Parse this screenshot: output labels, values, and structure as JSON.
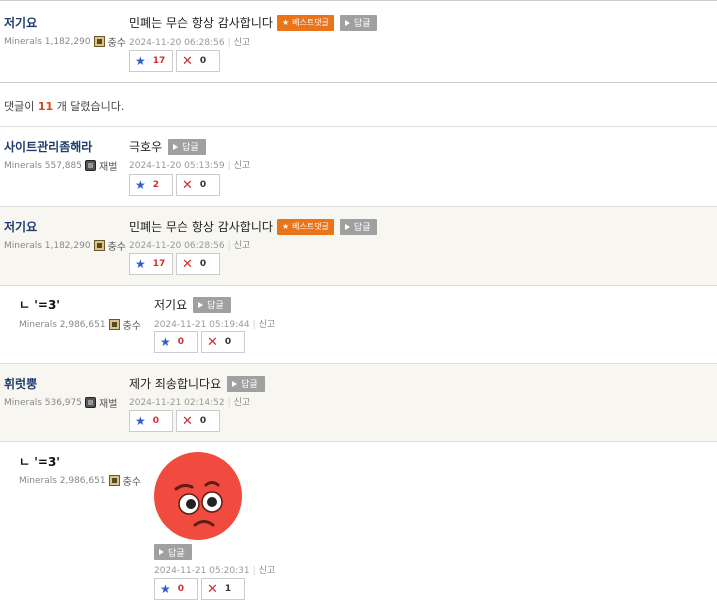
{
  "best_comment": {
    "nick": "저기요",
    "minerals": "Minerals 1,182,290",
    "rank": "충수",
    "text": "민폐는 무슨 항상 감사합니다",
    "best_label": "베스트댓글",
    "reply_label": "답글",
    "time": "2024-11-20 06:28:56",
    "report": "신고",
    "up": "17",
    "down": "0"
  },
  "count_line": {
    "prefix": "댓글이",
    "count": "11",
    "suffix": "개 달렸습니다."
  },
  "comments": [
    {
      "nick": "사이트관리좀해라",
      "minerals": "Minerals 557,885",
      "rank": "재벌",
      "text": "극호우",
      "reply_label": "답글",
      "time": "2024-11-20 05:13:59",
      "report": "신고",
      "up": "2",
      "down": "0"
    },
    {
      "nick": "저기요",
      "minerals": "Minerals 1,182,290",
      "rank": "충수",
      "text": "민폐는 무슨 항상 감사합니다",
      "best_label": "베스트댓글",
      "reply_label": "답글",
      "time": "2024-11-20 06:28:56",
      "report": "신고",
      "up": "17",
      "down": "0"
    },
    {
      "nick": "ㄴ '=3'",
      "minerals": "Minerals 2,986,651",
      "rank": "충수",
      "text": "저기요",
      "reply_label": "답글",
      "time": "2024-11-21 05:19:44",
      "report": "신고",
      "up": "0",
      "down": "0"
    },
    {
      "nick": "휘럿뿡",
      "minerals": "Minerals 536,975",
      "rank": "재벌",
      "text": "제가 죄송합니다요",
      "reply_label": "답글",
      "time": "2024-11-21 02:14:52",
      "report": "신고",
      "up": "0",
      "down": "0"
    },
    {
      "nick": "ㄴ '=3'",
      "minerals": "Minerals 2,986,651",
      "rank": "충수",
      "reply_label": "답글",
      "time": "2024-11-21 05:20:31",
      "report": "신고",
      "up": "0",
      "down": "1"
    }
  ],
  "colors": {
    "nick": "#1e3c6e",
    "best_badge": "#e9741a",
    "reply_button": "#a0a0a0",
    "up_count": "#d0302a",
    "alt_row_bg": "#f7f6f1"
  },
  "icons": {
    "up": "star-icon",
    "down": "x-icon",
    "reply": "play-triangle-icon",
    "emoji": "worried-red-face-emoji"
  }
}
